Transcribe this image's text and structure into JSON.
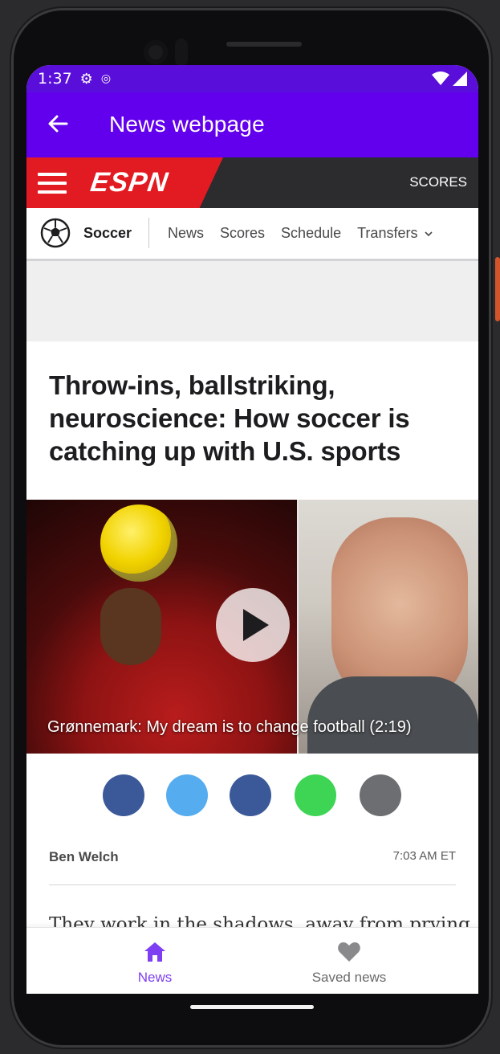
{
  "status_bar": {
    "time": "1:37",
    "icons": [
      "gear-icon",
      "location-icon",
      "wifi-icon",
      "signal-icon"
    ]
  },
  "app_bar": {
    "title": "News webpage",
    "back_icon": "arrow-back-icon"
  },
  "espn_header": {
    "logo_text": "ESPN",
    "menu_icon": "hamburger-icon",
    "scores_label": "SCORES",
    "brand_color": "#e21b22"
  },
  "sport_nav": {
    "sport": "Soccer",
    "links": [
      "News",
      "Scores",
      "Schedule",
      "Transfers"
    ],
    "transfers_dropdown_icon": "chevron-down-icon"
  },
  "article": {
    "headline": "Throw-ins, ballstriking, neuroscience: How soccer is catching up with U.S. sports",
    "video_caption": "Grønnemark: My dream is to change football (2:19)",
    "author": "Ben Welch",
    "time": "7:03 AM ET",
    "body_first_line": "They work in the shadows, away from prying"
  },
  "share_buttons": [
    {
      "name": "facebook-share-button",
      "color": "#3b5998"
    },
    {
      "name": "twitter-share-button",
      "color": "#55acee"
    },
    {
      "name": "messenger-share-button",
      "color": "#3b5998"
    },
    {
      "name": "whatsapp-share-button",
      "color": "#3ed454"
    },
    {
      "name": "email-share-button",
      "color": "#6d6e71"
    }
  ],
  "bottom_nav": {
    "items": [
      {
        "label": "News",
        "icon": "home-icon",
        "active": true,
        "color": "#7e3ff2"
      },
      {
        "label": "Saved news",
        "icon": "heart-icon",
        "active": false,
        "color": "#8a8a8c"
      }
    ]
  },
  "colors": {
    "app_bar": "#6200ee",
    "status_bar": "#5a0ed9"
  }
}
